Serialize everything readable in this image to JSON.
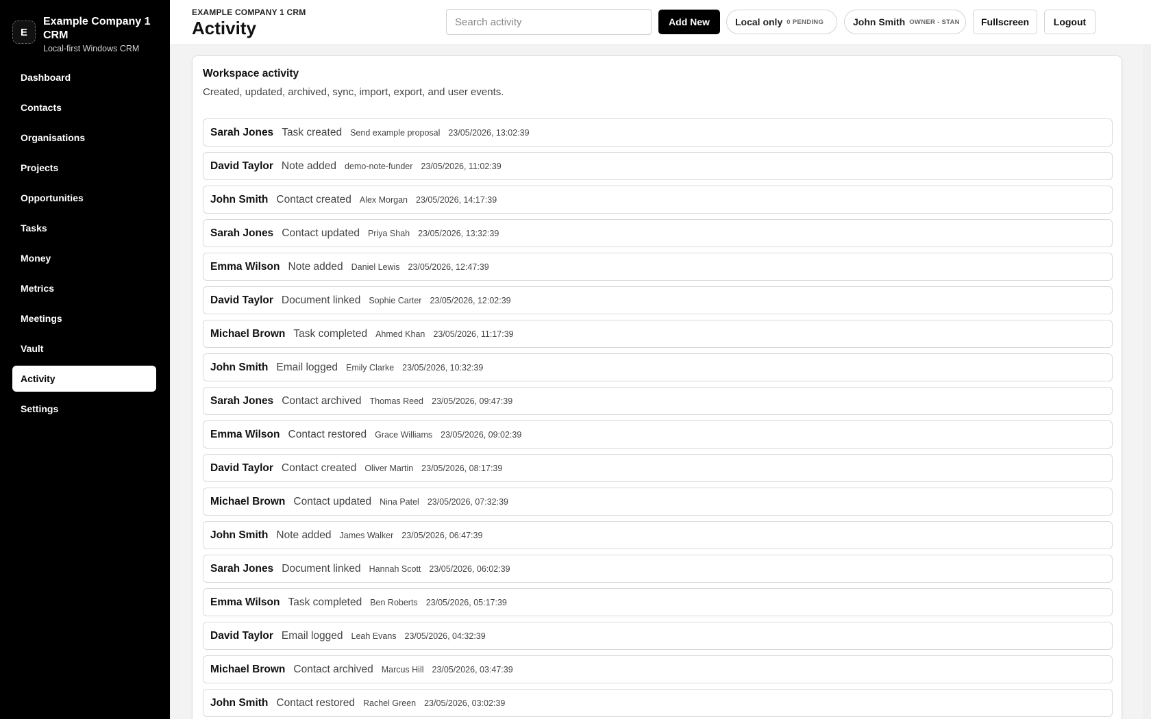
{
  "brand": {
    "logo_letter": "E",
    "name": "Example Company 1 CRM",
    "subtitle": "Local-first Windows CRM"
  },
  "sidebar": {
    "items": [
      {
        "label": "Dashboard",
        "active": false
      },
      {
        "label": "Contacts",
        "active": false
      },
      {
        "label": "Organisations",
        "active": false
      },
      {
        "label": "Projects",
        "active": false
      },
      {
        "label": "Opportunities",
        "active": false
      },
      {
        "label": "Tasks",
        "active": false
      },
      {
        "label": "Money",
        "active": false
      },
      {
        "label": "Metrics",
        "active": false
      },
      {
        "label": "Meetings",
        "active": false
      },
      {
        "label": "Vault",
        "active": false
      },
      {
        "label": "Activity",
        "active": true
      },
      {
        "label": "Settings",
        "active": false
      }
    ]
  },
  "header": {
    "breadcrumb": "EXAMPLE COMPANY 1 CRM",
    "title": "Activity",
    "search_placeholder": "Search activity",
    "search_value": "",
    "add_new_label": "Add New",
    "sync_label": "Local only",
    "sync_status": "0 PENDING",
    "user_name": "John Smith",
    "user_role": "OWNER - STAN",
    "fullscreen_label": "Fullscreen",
    "logout_label": "Logout"
  },
  "card": {
    "title": "Workspace activity",
    "description": "Created, updated, archived, sync, import, export, and user events."
  },
  "activity": [
    {
      "actor": "Sarah Jones",
      "action": "Task created",
      "subject": "Send example proposal",
      "time": "23/05/2026, 13:02:39"
    },
    {
      "actor": "David Taylor",
      "action": "Note added",
      "subject": "demo-note-funder",
      "time": "23/05/2026, 11:02:39"
    },
    {
      "actor": "John Smith",
      "action": "Contact created",
      "subject": "Alex Morgan",
      "time": "23/05/2026, 14:17:39"
    },
    {
      "actor": "Sarah Jones",
      "action": "Contact updated",
      "subject": "Priya Shah",
      "time": "23/05/2026, 13:32:39"
    },
    {
      "actor": "Emma Wilson",
      "action": "Note added",
      "subject": "Daniel Lewis",
      "time": "23/05/2026, 12:47:39"
    },
    {
      "actor": "David Taylor",
      "action": "Document linked",
      "subject": "Sophie Carter",
      "time": "23/05/2026, 12:02:39"
    },
    {
      "actor": "Michael Brown",
      "action": "Task completed",
      "subject": "Ahmed Khan",
      "time": "23/05/2026, 11:17:39"
    },
    {
      "actor": "John Smith",
      "action": "Email logged",
      "subject": "Emily Clarke",
      "time": "23/05/2026, 10:32:39"
    },
    {
      "actor": "Sarah Jones",
      "action": "Contact archived",
      "subject": "Thomas Reed",
      "time": "23/05/2026, 09:47:39"
    },
    {
      "actor": "Emma Wilson",
      "action": "Contact restored",
      "subject": "Grace Williams",
      "time": "23/05/2026, 09:02:39"
    },
    {
      "actor": "David Taylor",
      "action": "Contact created",
      "subject": "Oliver Martin",
      "time": "23/05/2026, 08:17:39"
    },
    {
      "actor": "Michael Brown",
      "action": "Contact updated",
      "subject": "Nina Patel",
      "time": "23/05/2026, 07:32:39"
    },
    {
      "actor": "John Smith",
      "action": "Note added",
      "subject": "James Walker",
      "time": "23/05/2026, 06:47:39"
    },
    {
      "actor": "Sarah Jones",
      "action": "Document linked",
      "subject": "Hannah Scott",
      "time": "23/05/2026, 06:02:39"
    },
    {
      "actor": "Emma Wilson",
      "action": "Task completed",
      "subject": "Ben Roberts",
      "time": "23/05/2026, 05:17:39"
    },
    {
      "actor": "David Taylor",
      "action": "Email logged",
      "subject": "Leah Evans",
      "time": "23/05/2026, 04:32:39"
    },
    {
      "actor": "Michael Brown",
      "action": "Contact archived",
      "subject": "Marcus Hill",
      "time": "23/05/2026, 03:47:39"
    },
    {
      "actor": "John Smith",
      "action": "Contact restored",
      "subject": "Rachel Green",
      "time": "23/05/2026, 03:02:39"
    }
  ]
}
